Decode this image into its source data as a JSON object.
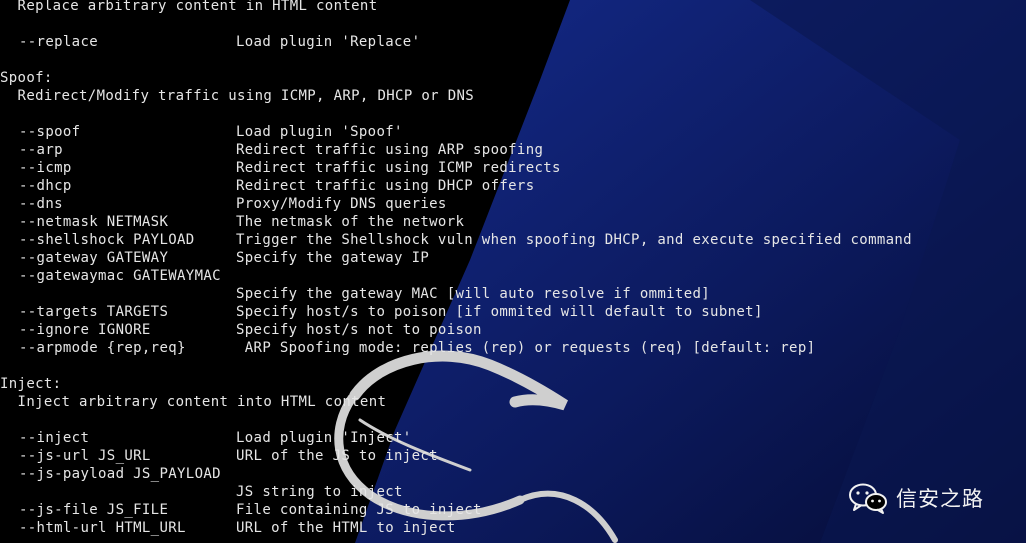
{
  "colors": {
    "background": "#000000",
    "panel_blue": "#0c1a5e",
    "text": "#e6e6e6",
    "dragon": "#cfcfcf"
  },
  "terminal": {
    "lines": [
      {
        "kind": "text",
        "text": "  Replace arbitrary content in HTML content"
      },
      {
        "kind": "blank"
      },
      {
        "kind": "option",
        "opt": "--replace",
        "desc": "Load plugin 'Replace'"
      },
      {
        "kind": "blank"
      },
      {
        "kind": "heading",
        "text": "Spoof:"
      },
      {
        "kind": "text",
        "text": "  Redirect/Modify traffic using ICMP, ARP, DHCP or DNS"
      },
      {
        "kind": "blank"
      },
      {
        "kind": "option",
        "opt": "--spoof",
        "desc": "Load plugin 'Spoof'"
      },
      {
        "kind": "option",
        "opt": "--arp",
        "desc": "Redirect traffic using ARP spoofing"
      },
      {
        "kind": "option",
        "opt": "--icmp",
        "desc": "Redirect traffic using ICMP redirects"
      },
      {
        "kind": "option",
        "opt": "--dhcp",
        "desc": "Redirect traffic using DHCP offers"
      },
      {
        "kind": "option",
        "opt": "--dns",
        "desc": "Proxy/Modify DNS queries"
      },
      {
        "kind": "option",
        "opt": "--netmask NETMASK",
        "desc": "The netmask of the network"
      },
      {
        "kind": "option",
        "opt": "--shellshock PAYLOAD",
        "desc": "Trigger the Shellshock vuln when spoofing DHCP, and execute specified command"
      },
      {
        "kind": "option",
        "opt": "--gateway GATEWAY",
        "desc": "Specify the gateway IP"
      },
      {
        "kind": "option",
        "opt": "--gatewaymac GATEWAYMAC",
        "desc": ""
      },
      {
        "kind": "option",
        "opt": "",
        "desc": "Specify the gateway MAC [will auto resolve if ommited]"
      },
      {
        "kind": "option",
        "opt": "--targets TARGETS",
        "desc": "Specify host/s to poison [if ommited will default to subnet]"
      },
      {
        "kind": "option",
        "opt": "--ignore IGNORE",
        "desc": "Specify host/s not to poison"
      },
      {
        "kind": "option",
        "opt": "--arpmode {rep,req}",
        "desc": " ARP Spoofing mode: replies (rep) or requests (req) [default: rep]"
      },
      {
        "kind": "blank"
      },
      {
        "kind": "heading",
        "text": "Inject:"
      },
      {
        "kind": "text",
        "text": "  Inject arbitrary content into HTML content"
      },
      {
        "kind": "blank"
      },
      {
        "kind": "option",
        "opt": "--inject",
        "desc": "Load plugin 'Inject'"
      },
      {
        "kind": "option",
        "opt": "--js-url JS_URL",
        "desc": "URL of the JS to inject"
      },
      {
        "kind": "option",
        "opt": "--js-payload JS_PAYLOAD",
        "desc": ""
      },
      {
        "kind": "option",
        "opt": "",
        "desc": "JS string to inject"
      },
      {
        "kind": "option",
        "opt": "--js-file JS_FILE",
        "desc": "File containing JS to inject"
      },
      {
        "kind": "option",
        "opt": "--html-url HTML_URL",
        "desc": "URL of the HTML to inject"
      }
    ]
  },
  "watermark": {
    "icon": "wechat-icon",
    "text": "信安之路"
  }
}
